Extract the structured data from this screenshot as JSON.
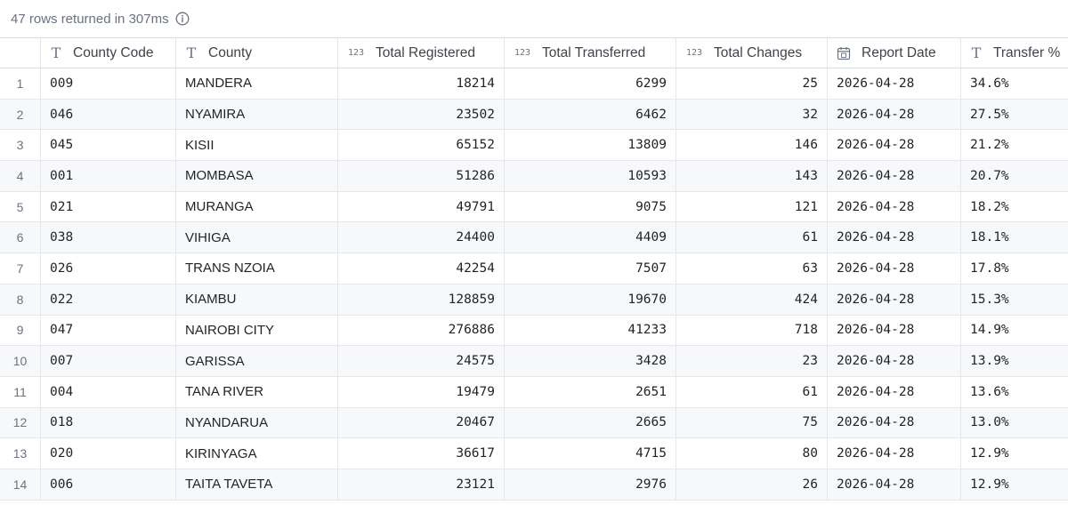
{
  "status": {
    "text": "47 rows returned in 307ms"
  },
  "columns": [
    {
      "label": "County Code",
      "type_icon": "text-type-icon"
    },
    {
      "label": "County",
      "type_icon": "text-type-icon"
    },
    {
      "label": "Total Registered",
      "type_icon": "number-type-icon"
    },
    {
      "label": "Total Transferred",
      "type_icon": "number-type-icon"
    },
    {
      "label": "Total Changes",
      "type_icon": "number-type-icon"
    },
    {
      "label": "Report Date",
      "type_icon": "calendar-type-icon"
    },
    {
      "label": "Transfer %",
      "type_icon": "text-type-icon"
    }
  ],
  "type_glyphs": {
    "text": "T",
    "number": "123"
  },
  "rows": [
    {
      "idx": "1",
      "code": "009",
      "county": "MANDERA",
      "registered": "18214",
      "transferred": "6299",
      "changes": "25",
      "date": "2026-04-28",
      "pct": "34.6%"
    },
    {
      "idx": "2",
      "code": "046",
      "county": "NYAMIRA",
      "registered": "23502",
      "transferred": "6462",
      "changes": "32",
      "date": "2026-04-28",
      "pct": "27.5%"
    },
    {
      "idx": "3",
      "code": "045",
      "county": "KISII",
      "registered": "65152",
      "transferred": "13809",
      "changes": "146",
      "date": "2026-04-28",
      "pct": "21.2%"
    },
    {
      "idx": "4",
      "code": "001",
      "county": "MOMBASA",
      "registered": "51286",
      "transferred": "10593",
      "changes": "143",
      "date": "2026-04-28",
      "pct": "20.7%"
    },
    {
      "idx": "5",
      "code": "021",
      "county": "MURANGA",
      "registered": "49791",
      "transferred": "9075",
      "changes": "121",
      "date": "2026-04-28",
      "pct": "18.2%"
    },
    {
      "idx": "6",
      "code": "038",
      "county": "VIHIGA",
      "registered": "24400",
      "transferred": "4409",
      "changes": "61",
      "date": "2026-04-28",
      "pct": "18.1%"
    },
    {
      "idx": "7",
      "code": "026",
      "county": "TRANS NZOIA",
      "registered": "42254",
      "transferred": "7507",
      "changes": "63",
      "date": "2026-04-28",
      "pct": "17.8%"
    },
    {
      "idx": "8",
      "code": "022",
      "county": "KIAMBU",
      "registered": "128859",
      "transferred": "19670",
      "changes": "424",
      "date": "2026-04-28",
      "pct": "15.3%"
    },
    {
      "idx": "9",
      "code": "047",
      "county": "NAIROBI CITY",
      "registered": "276886",
      "transferred": "41233",
      "changes": "718",
      "date": "2026-04-28",
      "pct": "14.9%"
    },
    {
      "idx": "10",
      "code": "007",
      "county": "GARISSA",
      "registered": "24575",
      "transferred": "3428",
      "changes": "23",
      "date": "2026-04-28",
      "pct": "13.9%"
    },
    {
      "idx": "11",
      "code": "004",
      "county": "TANA RIVER",
      "registered": "19479",
      "transferred": "2651",
      "changes": "61",
      "date": "2026-04-28",
      "pct": "13.6%"
    },
    {
      "idx": "12",
      "code": "018",
      "county": "NYANDARUA",
      "registered": "20467",
      "transferred": "2665",
      "changes": "75",
      "date": "2026-04-28",
      "pct": "13.0%"
    },
    {
      "idx": "13",
      "code": "020",
      "county": "KIRINYAGA",
      "registered": "36617",
      "transferred": "4715",
      "changes": "80",
      "date": "2026-04-28",
      "pct": "12.9%"
    },
    {
      "idx": "14",
      "code": "006",
      "county": "TAITA TAVETA",
      "registered": "23121",
      "transferred": "2976",
      "changes": "26",
      "date": "2026-04-28",
      "pct": "12.9%"
    }
  ]
}
